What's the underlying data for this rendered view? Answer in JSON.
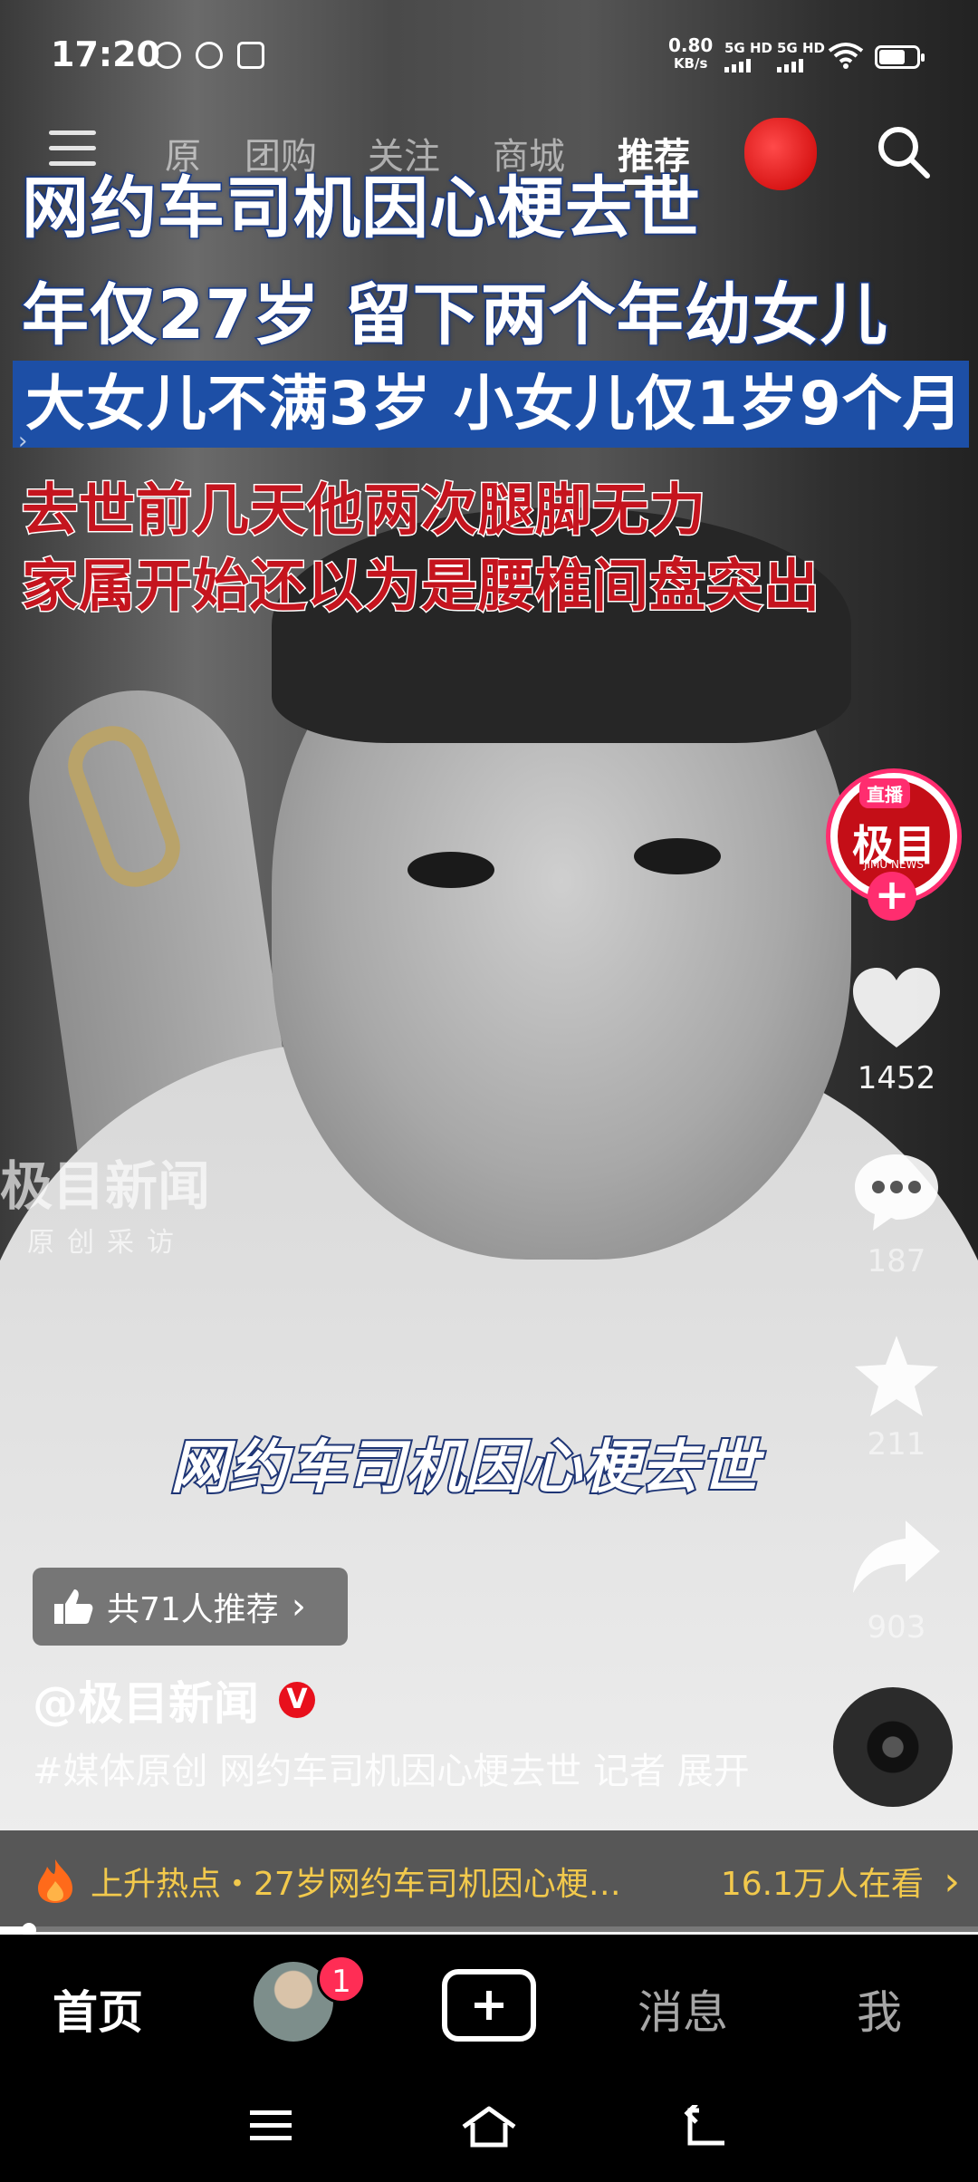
{
  "status_bar": {
    "time": "17:20",
    "net_speed": "0.80",
    "net_unit": "KB/s",
    "sim1": "5G HD",
    "sim2": "5G HD"
  },
  "top_nav": {
    "tabs": [
      "原",
      "团购",
      "关注",
      "商城",
      "推荐"
    ],
    "active_tab": "推荐"
  },
  "captions": {
    "line1": "网约车司机因心梗去世",
    "line2": "年仅27岁 留下两个年幼女儿",
    "line3": "大女儿不满3岁 小女儿仅1岁9个月",
    "line4": "去世前几天他两次腿脚无力",
    "line5": "家属开始还以为是腰椎间盘突出",
    "subtitle": "网约车司机因心梗去世"
  },
  "watermark": {
    "brand": "极目新闻",
    "tagline": "原创采访"
  },
  "creator_avatar": {
    "live_tag": "直播",
    "brand": "极目",
    "brand_sub": "JIMU NEWS"
  },
  "actions": {
    "likes": "1452",
    "comments": "187",
    "favorites": "211",
    "shares": "903"
  },
  "recommend": {
    "label": "共71人推荐"
  },
  "author": {
    "handle": "@极目新闻",
    "verified_badge": "V"
  },
  "description": "#媒体原创 网约车司机因心梗去世 记者 展开",
  "hot_bar": {
    "text": "上升热点・27岁网约车司机因心梗…",
    "watching": "16.1万人在看"
  },
  "playback": {
    "progress_fraction": 0.03
  },
  "tab_bar": {
    "home": "首页",
    "friends_badge": "1",
    "messages": "消息",
    "me": "我"
  },
  "colors": {
    "caption_red": "#c5141e",
    "caption_blue_band": "#1d4fa6",
    "accent_pink": "#ff2d6f",
    "hot_text": "#f2c94c"
  }
}
